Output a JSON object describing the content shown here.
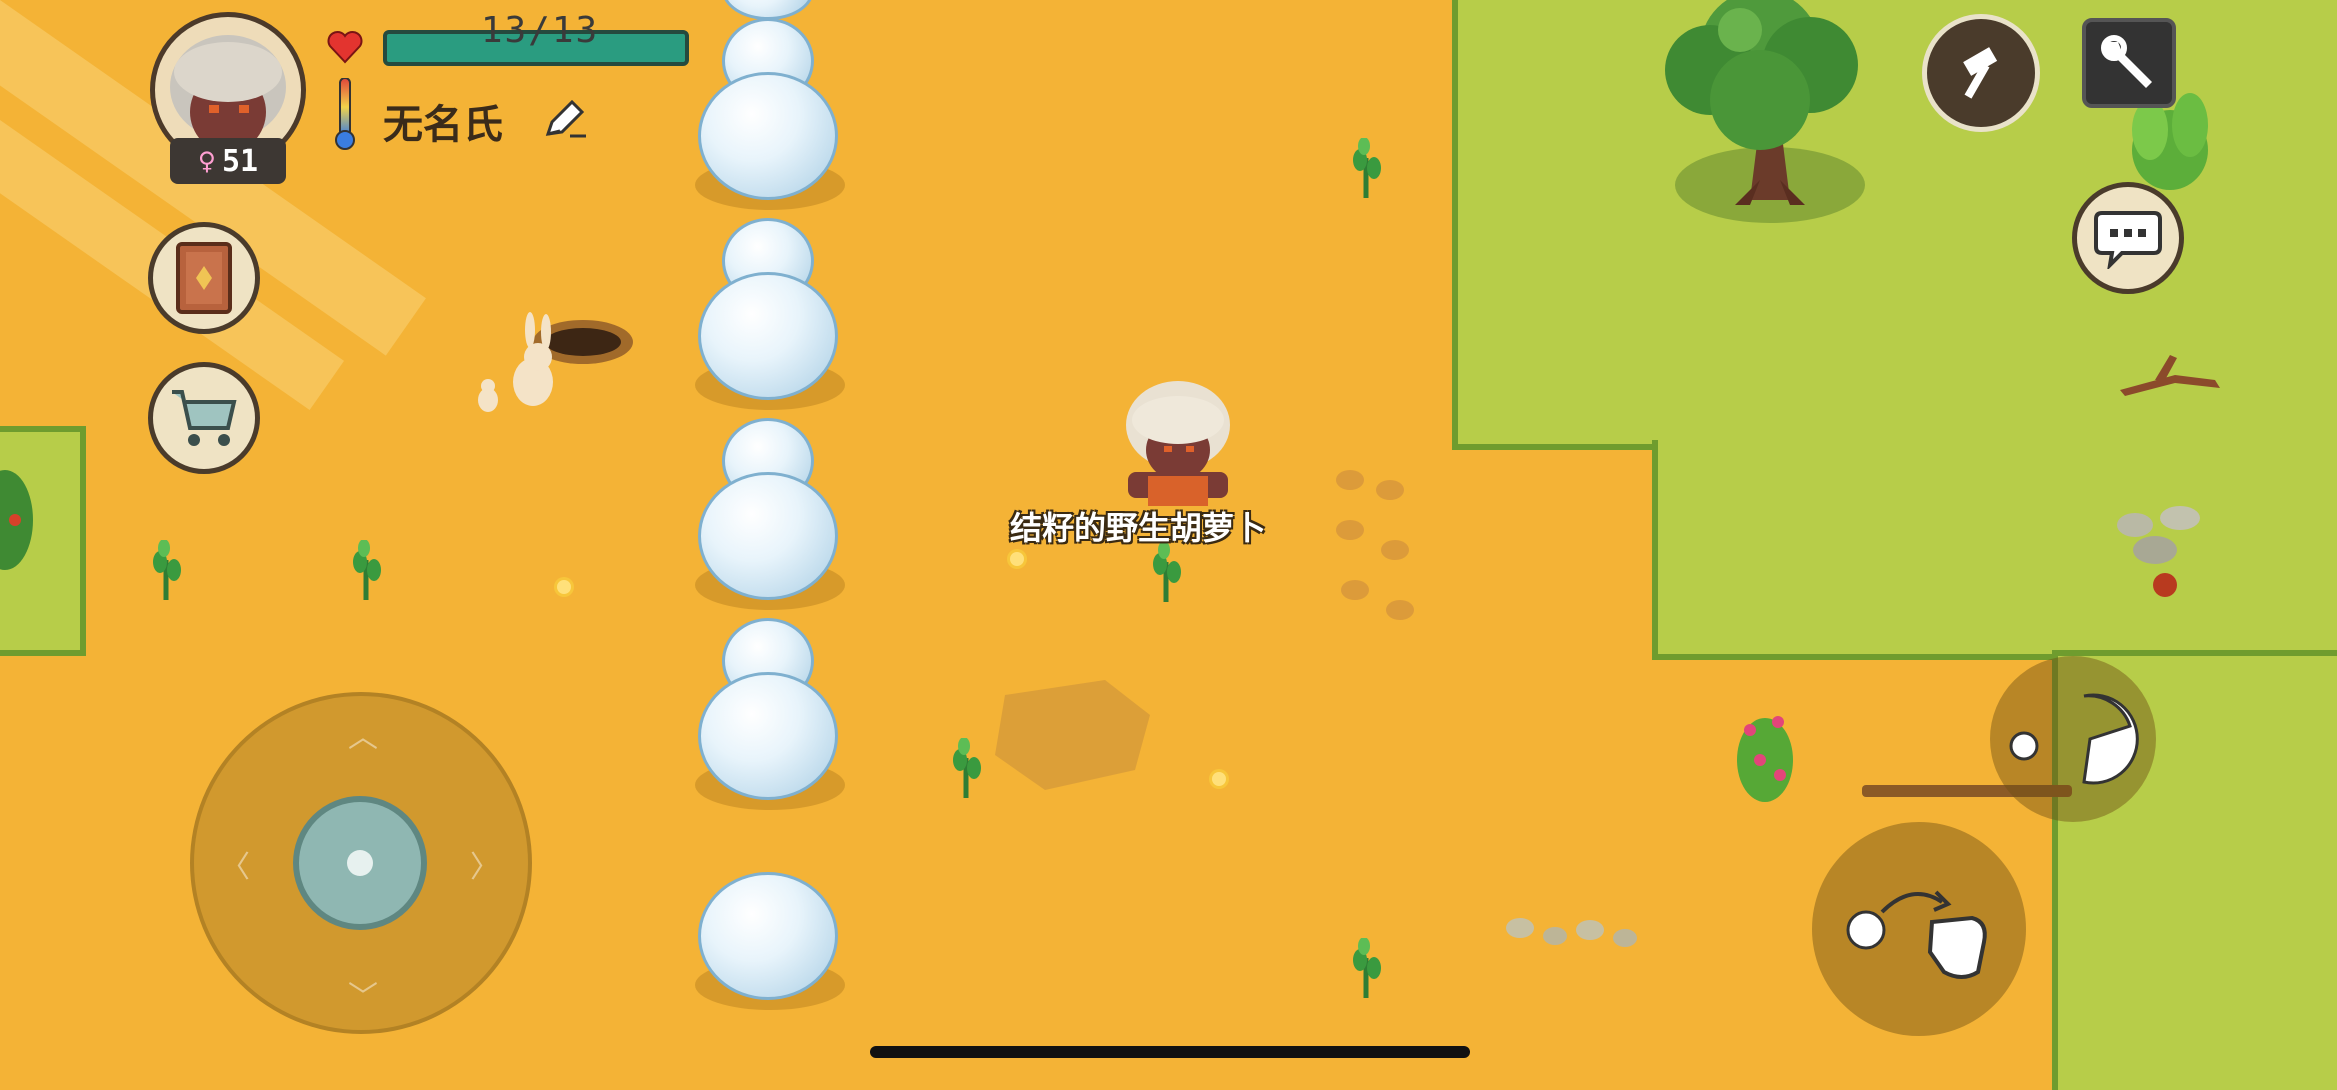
{
  "hud": {
    "health_text": "13/13",
    "player_name": "无名氏",
    "age": "51",
    "gender_symbol": "♀",
    "health_fraction": 1.0
  },
  "world": {
    "item_label": "结籽的野生胡萝卜"
  },
  "colors": {
    "sand": "#f4b336",
    "grass": "#b7cd49",
    "health": "#2a9c80",
    "snow": "#e8f4fb"
  },
  "icons": {
    "recipe_book": "book-icon",
    "shop": "shopping-cart-icon",
    "craft": "hammer-icon",
    "settings": "wrench-icon",
    "chat": "chat-bubble-icon",
    "eat": "eat-mouth-icon",
    "throw": "throw-hand-icon",
    "edit_name": "pencil-icon"
  }
}
